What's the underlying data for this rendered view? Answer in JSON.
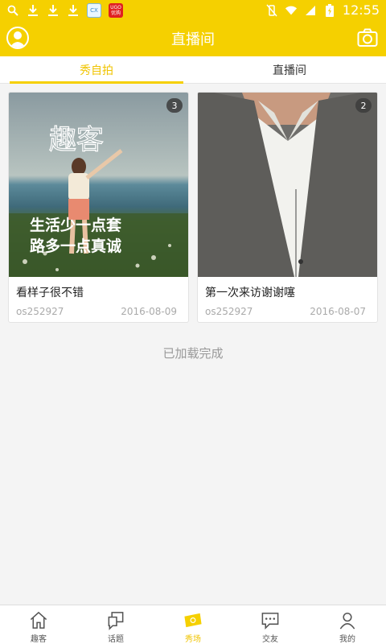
{
  "status_bar": {
    "time": "12:55",
    "icons": [
      "search-icon",
      "download-icon",
      "download-icon",
      "download-icon",
      "app-icon",
      "app-icon"
    ],
    "app1_text": "CX",
    "app2_text": "UGO 优购"
  },
  "header": {
    "title": "直播间",
    "left_icon": "profile-icon",
    "right_icon": "camera-icon"
  },
  "tabs": [
    {
      "label": "秀自拍",
      "active": true
    },
    {
      "label": "直播间",
      "active": false
    }
  ],
  "cards": [
    {
      "count": "3",
      "title": "看样子很不错",
      "user": "os252927",
      "date": "2016-08-09",
      "image_text_top": "趣客",
      "image_text_line1": "生活少一点套",
      "image_text_line2": "路多一点真诚"
    },
    {
      "count": "2",
      "title": "第一次来访谢谢噻",
      "user": "os252927",
      "date": "2016-08-07"
    }
  ],
  "footer_status": "已加载完成",
  "bottom_nav": [
    {
      "label": "趣客",
      "icon": "home-icon",
      "active": false
    },
    {
      "label": "话题",
      "icon": "topic-icon",
      "active": false
    },
    {
      "label": "秀场",
      "icon": "ticket-icon",
      "active": true
    },
    {
      "label": "交友",
      "icon": "chat-icon",
      "active": false
    },
    {
      "label": "我的",
      "icon": "person-icon",
      "active": false
    }
  ],
  "colors": {
    "accent": "#f5d000",
    "active_text": "#f0c400"
  }
}
